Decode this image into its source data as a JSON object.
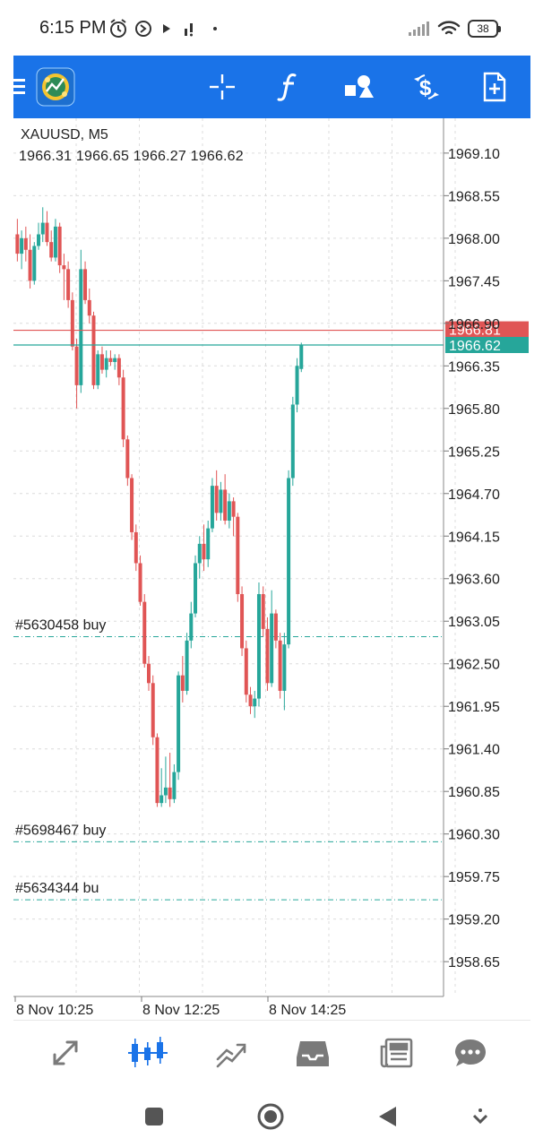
{
  "status_bar": {
    "time": "6:15 PM",
    "battery": "38",
    "icons": [
      "alarm-icon",
      "media-icon",
      "play-icon",
      "signal-activity-icon",
      "dot-icon",
      "cell-signal-icon",
      "wifi-icon",
      "battery-icon"
    ]
  },
  "toolbar": {
    "buttons": [
      "menu-icon",
      "app-logo",
      "crosshair-icon",
      "indicators-icon",
      "objects-icon",
      "trade-icon",
      "new-order-icon"
    ],
    "colors": {
      "background": "#1a73e8",
      "icon": "#ffffff"
    }
  },
  "chart": {
    "symbol": "XAUUSD, M5",
    "ohlc": "1966.31 1966.65 1966.27 1966.62",
    "price_labels": [
      "1969.10",
      "1968.55",
      "1968.00",
      "1967.45",
      "1966.90",
      "1966.35",
      "1965.80",
      "1965.25",
      "1964.70",
      "1964.15",
      "1963.60",
      "1963.05",
      "1962.50",
      "1961.95",
      "1961.40",
      "1960.85",
      "1960.30",
      "1959.75",
      "1959.20",
      "1958.65"
    ],
    "bid_label": "1966.62",
    "ask_label": "1966.81",
    "time_labels": [
      "8 Nov 10:25",
      "8 Nov 12:25",
      "8 Nov 14:25"
    ],
    "orders": [
      {
        "label": "#5630458 buy",
        "price": 1962.85
      },
      {
        "label": "#5698467 buy",
        "price": 1960.2
      },
      {
        "label": "#5634344 bu",
        "price": 1959.45
      }
    ],
    "colors": {
      "bull": "#26a69a",
      "bear": "#e05555",
      "bid": "#26a69a",
      "ask": "#e05555",
      "grid": "#dcdcdc"
    }
  },
  "chart_data": {
    "type": "candlestick",
    "symbol": "XAUUSD",
    "timeframe": "M5",
    "x_axis_labels": [
      "8 Nov 10:25",
      "8 Nov 12:25",
      "8 Nov 14:25"
    ],
    "ylim": [
      1958.2,
      1969.55
    ],
    "bid": 1966.62,
    "ask": 1966.81,
    "candles": [
      {
        "o": 1968.05,
        "h": 1968.25,
        "l": 1967.7,
        "c": 1967.8
      },
      {
        "o": 1967.8,
        "h": 1968.1,
        "l": 1967.6,
        "c": 1968.0
      },
      {
        "o": 1968.0,
        "h": 1968.15,
        "l": 1967.7,
        "c": 1967.85
      },
      {
        "o": 1967.85,
        "h": 1968.05,
        "l": 1967.35,
        "c": 1967.45
      },
      {
        "o": 1967.45,
        "h": 1967.95,
        "l": 1967.4,
        "c": 1967.9
      },
      {
        "o": 1967.9,
        "h": 1968.2,
        "l": 1967.85,
        "c": 1968.05
      },
      {
        "o": 1968.05,
        "h": 1968.4,
        "l": 1967.95,
        "c": 1968.2
      },
      {
        "o": 1968.2,
        "h": 1968.35,
        "l": 1967.9,
        "c": 1967.95
      },
      {
        "o": 1967.95,
        "h": 1968.1,
        "l": 1967.7,
        "c": 1967.75
      },
      {
        "o": 1967.75,
        "h": 1968.25,
        "l": 1967.7,
        "c": 1968.15
      },
      {
        "o": 1968.15,
        "h": 1968.2,
        "l": 1967.55,
        "c": 1967.65
      },
      {
        "o": 1967.65,
        "h": 1967.8,
        "l": 1967.2,
        "c": 1967.6
      },
      {
        "o": 1967.6,
        "h": 1967.7,
        "l": 1967.1,
        "c": 1967.2
      },
      {
        "o": 1967.2,
        "h": 1967.3,
        "l": 1966.55,
        "c": 1966.6
      },
      {
        "o": 1966.6,
        "h": 1966.7,
        "l": 1965.8,
        "c": 1966.1
      },
      {
        "o": 1966.1,
        "h": 1967.85,
        "l": 1966.0,
        "c": 1967.6
      },
      {
        "o": 1967.6,
        "h": 1967.7,
        "l": 1967.15,
        "c": 1967.2
      },
      {
        "o": 1967.2,
        "h": 1967.35,
        "l": 1966.9,
        "c": 1967.0
      },
      {
        "o": 1967.0,
        "h": 1967.05,
        "l": 1966.05,
        "c": 1966.1
      },
      {
        "o": 1966.1,
        "h": 1966.55,
        "l": 1966.05,
        "c": 1966.5
      },
      {
        "o": 1966.5,
        "h": 1966.6,
        "l": 1966.25,
        "c": 1966.3
      },
      {
        "o": 1966.3,
        "h": 1966.55,
        "l": 1966.2,
        "c": 1966.45
      },
      {
        "o": 1966.45,
        "h": 1966.55,
        "l": 1966.35,
        "c": 1966.4
      },
      {
        "o": 1966.4,
        "h": 1966.5,
        "l": 1966.3,
        "c": 1966.45
      },
      {
        "o": 1966.45,
        "h": 1966.5,
        "l": 1966.1,
        "c": 1966.2
      },
      {
        "o": 1966.2,
        "h": 1966.3,
        "l": 1965.3,
        "c": 1965.4
      },
      {
        "o": 1965.4,
        "h": 1965.45,
        "l": 1964.8,
        "c": 1964.9
      },
      {
        "o": 1964.9,
        "h": 1964.95,
        "l": 1964.1,
        "c": 1964.2
      },
      {
        "o": 1964.2,
        "h": 1964.3,
        "l": 1963.7,
        "c": 1963.8
      },
      {
        "o": 1963.8,
        "h": 1963.9,
        "l": 1963.25,
        "c": 1963.3
      },
      {
        "o": 1963.3,
        "h": 1963.4,
        "l": 1962.45,
        "c": 1962.5
      },
      {
        "o": 1962.5,
        "h": 1962.6,
        "l": 1962.15,
        "c": 1962.25
      },
      {
        "o": 1962.25,
        "h": 1962.35,
        "l": 1961.45,
        "c": 1961.55
      },
      {
        "o": 1961.55,
        "h": 1961.6,
        "l": 1960.65,
        "c": 1960.7
      },
      {
        "o": 1960.7,
        "h": 1961.15,
        "l": 1960.65,
        "c": 1960.8
      },
      {
        "o": 1960.8,
        "h": 1961.3,
        "l": 1960.7,
        "c": 1960.9
      },
      {
        "o": 1960.9,
        "h": 1961.35,
        "l": 1960.65,
        "c": 1960.75
      },
      {
        "o": 1960.75,
        "h": 1961.2,
        "l": 1960.7,
        "c": 1961.1
      },
      {
        "o": 1961.1,
        "h": 1962.4,
        "l": 1961.0,
        "c": 1962.35
      },
      {
        "o": 1962.35,
        "h": 1962.6,
        "l": 1962.0,
        "c": 1962.15
      },
      {
        "o": 1962.15,
        "h": 1962.9,
        "l": 1962.1,
        "c": 1962.8
      },
      {
        "o": 1962.8,
        "h": 1963.3,
        "l": 1962.7,
        "c": 1963.15
      },
      {
        "o": 1963.15,
        "h": 1963.9,
        "l": 1963.1,
        "c": 1963.8
      },
      {
        "o": 1963.8,
        "h": 1964.15,
        "l": 1963.6,
        "c": 1964.05
      },
      {
        "o": 1964.05,
        "h": 1964.3,
        "l": 1963.7,
        "c": 1963.85
      },
      {
        "o": 1963.85,
        "h": 1964.35,
        "l": 1963.75,
        "c": 1964.25
      },
      {
        "o": 1964.25,
        "h": 1964.9,
        "l": 1964.2,
        "c": 1964.8
      },
      {
        "o": 1964.8,
        "h": 1965.0,
        "l": 1964.35,
        "c": 1964.45
      },
      {
        "o": 1964.45,
        "h": 1964.85,
        "l": 1964.35,
        "c": 1964.75
      },
      {
        "o": 1964.75,
        "h": 1964.95,
        "l": 1964.3,
        "c": 1964.35
      },
      {
        "o": 1964.35,
        "h": 1964.7,
        "l": 1964.25,
        "c": 1964.6
      },
      {
        "o": 1964.6,
        "h": 1964.65,
        "l": 1964.15,
        "c": 1964.4
      },
      {
        "o": 1964.4,
        "h": 1964.45,
        "l": 1963.3,
        "c": 1963.4
      },
      {
        "o": 1963.4,
        "h": 1963.5,
        "l": 1962.6,
        "c": 1962.7
      },
      {
        "o": 1962.7,
        "h": 1962.8,
        "l": 1962.0,
        "c": 1962.1
      },
      {
        "o": 1962.1,
        "h": 1962.2,
        "l": 1961.85,
        "c": 1961.95
      },
      {
        "o": 1961.95,
        "h": 1962.15,
        "l": 1961.8,
        "c": 1962.05
      },
      {
        "o": 1962.05,
        "h": 1963.55,
        "l": 1961.95,
        "c": 1963.4
      },
      {
        "o": 1963.4,
        "h": 1963.5,
        "l": 1962.85,
        "c": 1962.95
      },
      {
        "o": 1962.95,
        "h": 1963.1,
        "l": 1962.15,
        "c": 1962.25
      },
      {
        "o": 1962.25,
        "h": 1963.45,
        "l": 1962.2,
        "c": 1963.15
      },
      {
        "o": 1963.15,
        "h": 1963.2,
        "l": 1962.7,
        "c": 1962.8
      },
      {
        "o": 1962.8,
        "h": 1962.9,
        "l": 1962.05,
        "c": 1962.15
      },
      {
        "o": 1962.15,
        "h": 1962.9,
        "l": 1961.9,
        "c": 1962.75
      },
      {
        "o": 1962.75,
        "h": 1965.0,
        "l": 1962.7,
        "c": 1964.9
      },
      {
        "o": 1964.9,
        "h": 1965.95,
        "l": 1964.8,
        "c": 1965.85
      },
      {
        "o": 1965.85,
        "h": 1966.45,
        "l": 1965.75,
        "c": 1966.35
      },
      {
        "o": 1966.31,
        "h": 1966.65,
        "l": 1966.27,
        "c": 1966.62
      }
    ]
  },
  "bottom_nav": {
    "items": [
      "quotes-icon",
      "chart-icon",
      "trade-icon",
      "history-icon",
      "news-icon",
      "messages-icon"
    ],
    "active": "chart-icon",
    "colors": {
      "active": "#1a73e8",
      "inactive": "#7a7a7a"
    }
  },
  "android_nav": {
    "items": [
      "recents-button",
      "home-button",
      "back-button",
      "keyboard-hide-button"
    ]
  }
}
